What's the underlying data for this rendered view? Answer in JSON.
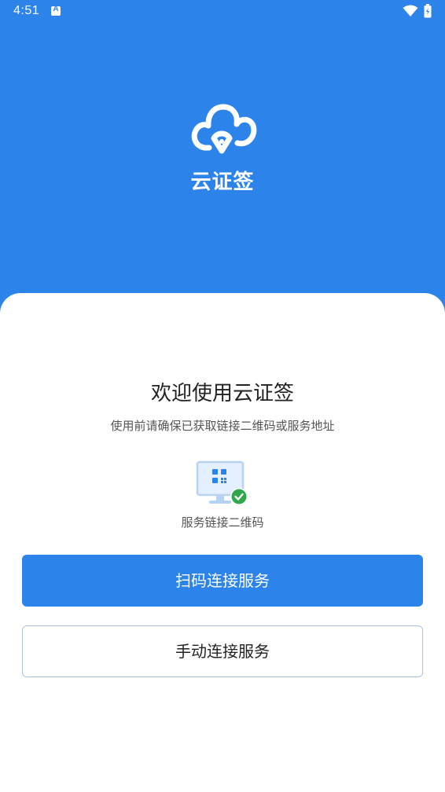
{
  "status_bar": {
    "time": "4:51",
    "notification_icon": "a-box-icon",
    "wifi_icon": "wifi-icon",
    "battery_icon": "battery-icon"
  },
  "header": {
    "logo_icon": "cloud-pen-logo-icon",
    "app_name": "云证签",
    "background_color": "#2c84ea"
  },
  "main": {
    "welcome_title": "欢迎使用云证签",
    "subtitle": "使用前请确保已获取链接二维码或服务地址",
    "illustration_icon": "monitor-qr-check-icon",
    "illustration_caption": "服务链接二维码",
    "scan_button_label": "扫码连接服务",
    "manual_button_label": "手动连接服务"
  },
  "colors": {
    "accent": "#2c84ea",
    "success": "#2ea84a"
  }
}
